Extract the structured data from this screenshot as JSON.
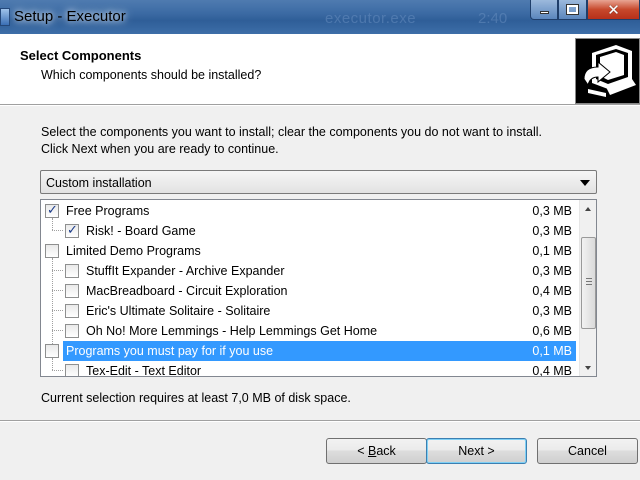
{
  "window": {
    "title": "Setup - Executor",
    "background_text": "executor.exe",
    "background_num": "2:40"
  },
  "header": {
    "title": "Select Components",
    "subtitle": "Which components should be installed?"
  },
  "intro": {
    "line1": "Select the components you want to install; clear the components you do not want to install.",
    "line2": "Click Next when you are ready to continue."
  },
  "install_type": {
    "selected": "Custom installation"
  },
  "components": [
    {
      "label": "Free Programs",
      "size": "0,3 MB",
      "checked": true,
      "level": 0
    },
    {
      "label": "Risk! - Board Game",
      "size": "0,3 MB",
      "checked": true,
      "level": 1
    },
    {
      "label": "Limited Demo Programs",
      "size": "0,1 MB",
      "checked": false,
      "level": 0
    },
    {
      "label": "StuffIt Expander - Archive Expander",
      "size": "0,3 MB",
      "checked": false,
      "level": 1
    },
    {
      "label": "MacBreadboard - Circuit Exploration",
      "size": "0,4 MB",
      "checked": false,
      "level": 1
    },
    {
      "label": "Eric's Ultimate Solitaire - Solitaire",
      "size": "0,3 MB",
      "checked": false,
      "level": 1
    },
    {
      "label": "Oh No! More Lemmings - Help Lemmings Get Home",
      "size": "0,6 MB",
      "checked": false,
      "level": 1
    },
    {
      "label": "Programs you must pay for if you use",
      "size": "0,1 MB",
      "checked": false,
      "level": 0,
      "selected": true
    },
    {
      "label": "Tex-Edit - Text Editor",
      "size": "0,4 MB",
      "checked": false,
      "level": 1
    }
  ],
  "status": {
    "space_required": "Current selection requires at least 7,0 MB of disk space."
  },
  "buttons": {
    "back_prefix": "< ",
    "back_accel": "B",
    "back_rest": "ack",
    "next": "Next >",
    "cancel": "Cancel"
  },
  "colors": {
    "selection": "#3399ff",
    "titlebar": "#3b6aa3",
    "close_button": "#c7482c"
  }
}
